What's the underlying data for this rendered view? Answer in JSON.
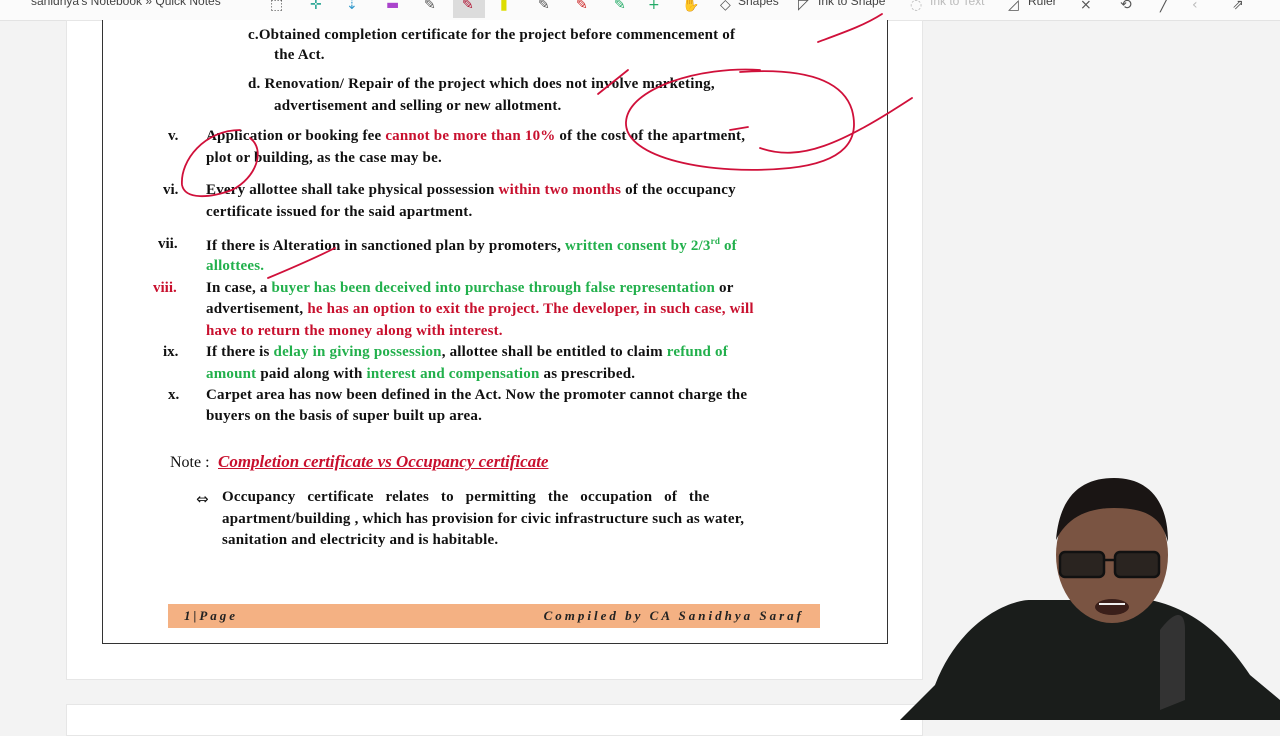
{
  "toolbar": {
    "title": "sanidhya's Notebook » Quick Notes",
    "shapes": "Shapes",
    "ink_to_shape": "Ink to Shape",
    "ink_to_text": "Ink to Text",
    "ruler": "Ruler"
  },
  "doc": {
    "c": {
      "prefix": "c.",
      "line1": "Obtained completion certificate for the project before commencement of",
      "line2": "the Act."
    },
    "d": {
      "prefix": "d.",
      "line1": "Renovation/ Repair of the project which does not involve marketing,",
      "line2": "advertisement  and selling or new allotment."
    },
    "v": {
      "num": "v.",
      "a": "Application or booking fee ",
      "b": "cannot be more than 10%",
      "c": " of the cost of the apartment,",
      "line2": "plot or building, as the case may  be."
    },
    "vi": {
      "num": "vi.",
      "a": "Every allottee shall take physical possession ",
      "b": "within two months",
      "c": " of the occupancy",
      "line2": "certificate issued for the said  apartment."
    },
    "vii": {
      "num": "vii.",
      "a": "If there is Alteration in sanctioned plan by promoters, ",
      "b": "written consent by 2/3",
      "sup": "rd",
      "c": " of",
      "line2": "allottees."
    },
    "viii": {
      "num": "viii.",
      "a": "In case, a ",
      "b": "buyer has been deceived into purchase through false representation",
      "c": " or",
      "d": "advertisement, ",
      "e": "he has an option to exit the project.  The developer, in such case, will",
      "line3": "have to return the money along with interest."
    },
    "ix": {
      "num": "ix.",
      "a": "If there is ",
      "b": "delay in giving possession",
      "c": ", allottee shall be entitled to claim ",
      "d": "refund of",
      "e": "amount",
      "f": " paid along with ",
      "g": "interest and compensation",
      "h": " as prescribed."
    },
    "x": {
      "num": "x.",
      "line1": "Carpet area has now been defined in the Act. Now the promoter cannot  charge the",
      "line2": "buyers on the basis of super built up area."
    },
    "note_label": "Note :",
    "note_title": "Completion certificate vs Occupancy certificate",
    "arrow": "⇔",
    "occ": {
      "line1": "Occupancy   certificate   relates   to   permitting   the   occupation   of   the",
      "line2": "apartment/building , which has provision for civic infrastructure such as water,",
      "line3": "sanitation and electricity and is habitable."
    },
    "footer_left": "1|Page",
    "footer_right": "Compiled by CA Sanidhya Saraf"
  },
  "colors": {
    "red": "#c8102e",
    "green": "#22b04c",
    "footer": "#f4b183"
  }
}
